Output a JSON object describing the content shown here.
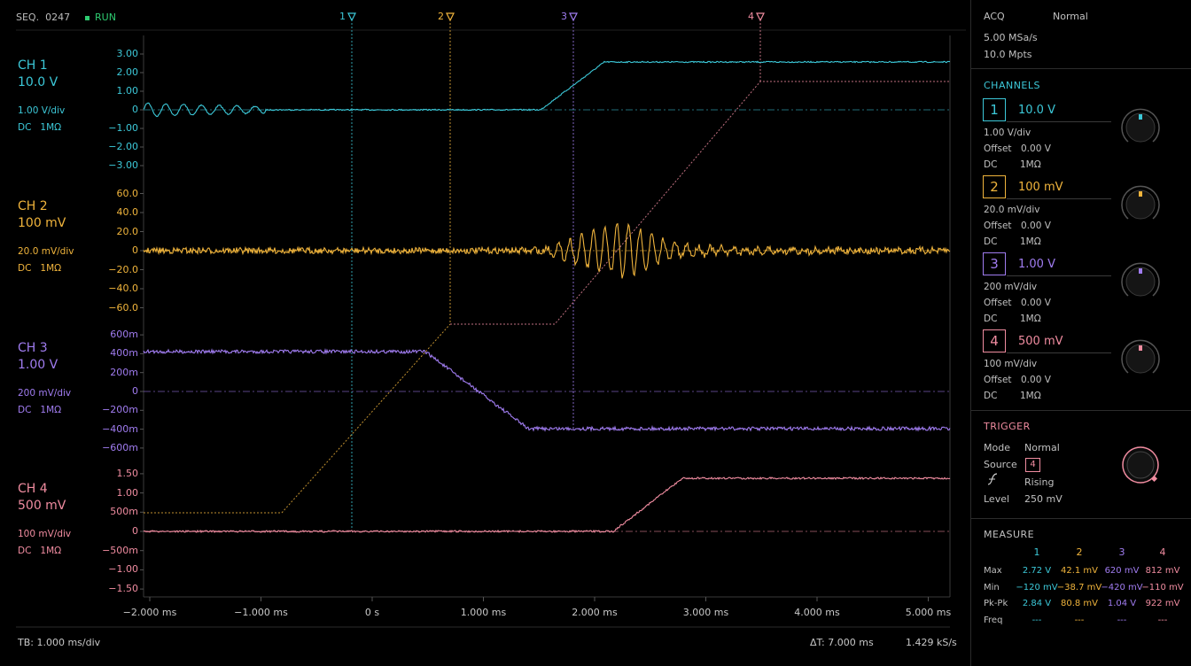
{
  "status": {
    "seq_label": "SEQ.",
    "seq": "0247",
    "run": "RUN",
    "run_color": "#2ecc71"
  },
  "colors": {
    "ch1": "#3cc8d8",
    "ch2": "#f0b43c",
    "ch3": "#a07cf0",
    "ch4": "#f08ca0",
    "grid": "#2a2a2a",
    "text": "#c8c8c8"
  },
  "channels": [
    {
      "id": "1",
      "name": "CH 1",
      "volts": "10.0 V",
      "scale": "1.00 V/div",
      "coupling": "DC",
      "impedance": "1MΩ",
      "offset_label": "Offset",
      "offset": "0.00 V",
      "ticks": [
        "3.00",
        "2.00",
        "1.00",
        "0",
        "−1.00",
        "−2.00",
        "−3.00"
      ]
    },
    {
      "id": "2",
      "name": "CH 2",
      "volts": "100 mV",
      "scale": "20.0 mV/div",
      "coupling": "DC",
      "impedance": "1MΩ",
      "offset_label": "Offset",
      "offset": "0.00 V",
      "ticks": [
        "60.0",
        "40.0",
        "20.0",
        "0",
        "−20.0",
        "−40.0",
        "−60.0"
      ]
    },
    {
      "id": "3",
      "name": "CH 3",
      "volts": "1.00 V",
      "scale": "200 mV/div",
      "coupling": "DC",
      "impedance": "1MΩ",
      "offset_label": "Offset",
      "offset": "0.00 V",
      "ticks": [
        "600m",
        "400m",
        "200m",
        "0",
        "−200m",
        "−400m",
        "−600m"
      ]
    },
    {
      "id": "4",
      "name": "CH 4",
      "volts": "500 mV",
      "scale": "100 mV/div",
      "coupling": "DC",
      "impedance": "1MΩ",
      "offset_label": "Offset",
      "offset": "0.00 V",
      "ticks": [
        "1.50",
        "1.00",
        "500m",
        "0",
        "−500m",
        "−1.00",
        "−1.50"
      ]
    }
  ],
  "cursors": [
    "1",
    "2",
    "3",
    "4"
  ],
  "time_axis": [
    "−2.000 ms",
    "−1.000 ms",
    "0 s",
    "1.000 ms",
    "2.000 ms",
    "3.000 ms",
    "4.000 ms",
    "5.000 ms"
  ],
  "footer": {
    "timebase": "TB:  1.000 ms/div",
    "delta_t": "ΔT:  7.000 ms",
    "rate": "1.429 kS/s"
  },
  "acq": {
    "title": "ACQ",
    "mode": "Normal",
    "sample_rate": "5.00 MSa/s",
    "memory": "10.0 Mpts"
  },
  "channels_title": "CHANNELS",
  "trigger": {
    "title": "TRIGGER",
    "mode_label": "Mode",
    "mode": "Normal",
    "source_label": "Source",
    "source": "4",
    "slope_icon": "rising-edge-icon",
    "slope": "Rising",
    "level_label": "Level",
    "level": "250 mV"
  },
  "measure": {
    "title": "MEASURE",
    "columns": [
      "1",
      "2",
      "3",
      "4"
    ],
    "rows": [
      {
        "label": "Max",
        "values": [
          "2.72 V",
          "42.1 mV",
          "620 mV",
          "812 mV"
        ]
      },
      {
        "label": "Min",
        "values": [
          "−120 mV",
          "−38.7 mV",
          "−420 mV",
          "−110 mV"
        ]
      },
      {
        "label": "Pk-Pk",
        "values": [
          "2.84 V",
          "80.8 mV",
          "1.04 V",
          "922 mV"
        ]
      },
      {
        "label": "Freq",
        "values": [
          "---",
          "---",
          "---",
          "---"
        ]
      }
    ]
  }
}
